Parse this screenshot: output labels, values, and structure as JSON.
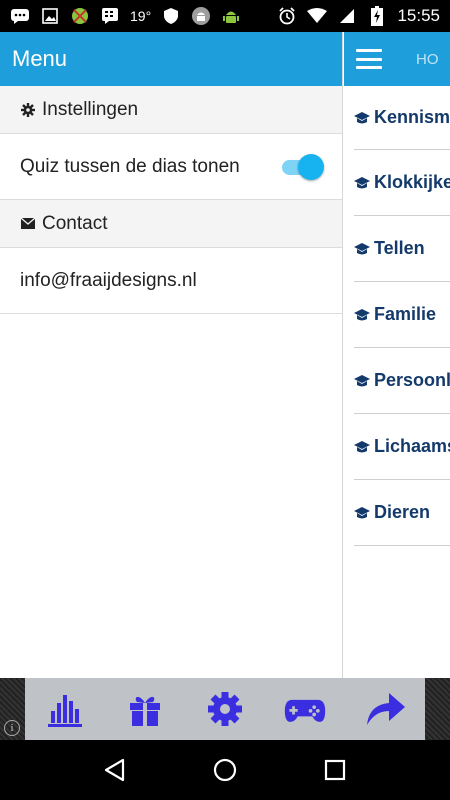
{
  "status_bar": {
    "temperature": "19°",
    "time": "15:55",
    "left_icons": [
      "chat-icon",
      "image-icon",
      "android-bug-icon",
      "blackberry-icon",
      "shield-icon",
      "android-icon",
      "android-green-icon"
    ],
    "right_icons": [
      "alarm-icon",
      "wifi-icon",
      "signal-icon",
      "battery-charging-icon"
    ]
  },
  "drawer": {
    "title": "Menu",
    "settings_section": {
      "icon": "gear-icon",
      "label": "Instellingen"
    },
    "quiz_toggle": {
      "label": "Quiz tussen de dias tonen",
      "enabled": true
    },
    "contact_section": {
      "icon": "envelope-icon",
      "label": "Contact"
    },
    "contact_email": "info@fraaijdesigns.nl"
  },
  "main": {
    "title": "HO",
    "items": [
      {
        "label": "Kennisma"
      },
      {
        "label": "Klokkijke"
      },
      {
        "label": "Tellen"
      },
      {
        "label": "Familie"
      },
      {
        "label": "Persoonl"
      },
      {
        "label": "Lichaams"
      },
      {
        "label": "Dieren"
      }
    ]
  },
  "ad_bar": {
    "info_label": "i",
    "icons": [
      "bar-chart-icon",
      "gift-icon",
      "gear-icon",
      "gamepad-icon",
      "share-arrow-icon"
    ]
  },
  "nav_bar": {
    "buttons": [
      "back-button",
      "home-button",
      "recents-button"
    ]
  },
  "colors": {
    "primary": "#1e9fdb",
    "accent": "#16b3f0",
    "item_text": "#143a6b",
    "ad_icon": "#3a2ee0"
  }
}
